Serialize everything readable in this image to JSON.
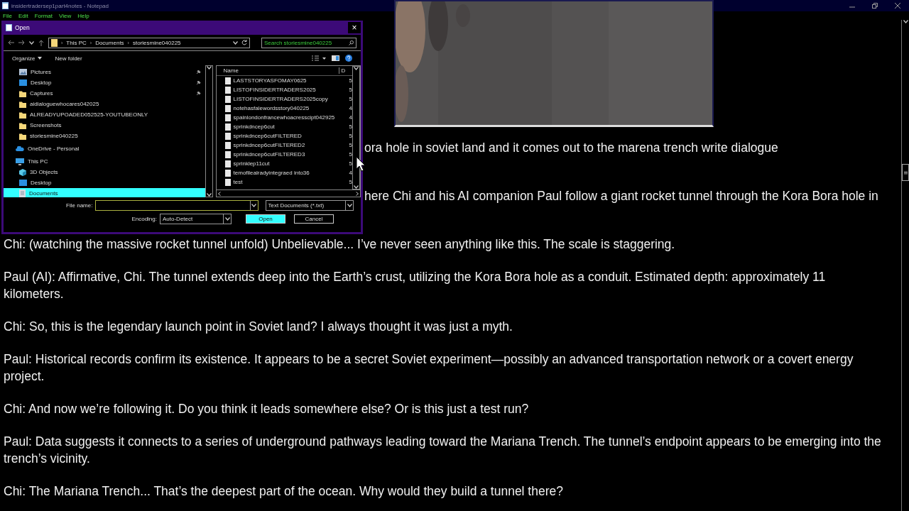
{
  "notepad": {
    "title": "insidertradersep1part4notes - Notepad",
    "menu": [
      "File",
      "Edit",
      "Format",
      "View",
      "Help"
    ],
    "paragraphs": [
      {
        "kind": "partial",
        "text": "ora hole in soviet land and it comes out to the marena trench write dialogue"
      },
      {
        "kind": "partial",
        "text": "here Chi and his AI companion Paul follow a giant rocket tunnel through the Kora Bora hole in"
      },
      {
        "kind": "full",
        "text": "Chi: (watching the massive rocket tunnel unfold) Unbelievable... I’ve never seen anything like this. The scale is staggering."
      },
      {
        "kind": "full",
        "text": "Paul (AI): Affirmative, Chi. The tunnel extends deep into the Earth’s crust, utilizing the Kora Bora hole as a conduit. Estimated depth: approximately 11 kilometers."
      },
      {
        "kind": "full",
        "text": "Chi: So, this is the legendary launch point in Soviet land? I always thought it was just a myth."
      },
      {
        "kind": "full",
        "text": "Paul: Historical records confirm its existence. It appears to be a secret Soviet experiment—possibly an advanced transportation network or a covert energy project."
      },
      {
        "kind": "full",
        "text": "Chi: And now we’re following it. Do you think it leads somewhere else? Or is this just a test run?"
      },
      {
        "kind": "full",
        "text": "Paul: Data suggests it connects to a series of underground pathways leading toward the Mariana Trench. The tunnel’s endpoint appears to be emerging into the trench’s vicinity."
      },
      {
        "kind": "full",
        "text": "Chi: The Mariana Trench... That’s the deepest part of the ocean. Why would they build a tunnel there?"
      }
    ]
  },
  "dialog": {
    "title": "Open",
    "close": "×",
    "address": {
      "segments": [
        {
          "separator": "›",
          "label": "This PC"
        },
        {
          "separator": "›",
          "label": "Documents"
        },
        {
          "separator": "›",
          "label": "storiesmine040225"
        }
      ]
    },
    "search": {
      "placeholder": "Search storiesmine040225"
    },
    "toolbar": {
      "organize": "Organize",
      "new_folder": "New folder"
    },
    "quick_access": [
      {
        "label": "Pictures",
        "kind": "pictures",
        "pinned": true,
        "selected": false
      },
      {
        "label": "Desktop",
        "kind": "desktop",
        "pinned": true,
        "selected": false
      },
      {
        "label": "Captures",
        "kind": "folder",
        "pinned": true,
        "selected": false
      },
      {
        "label": "aidialoguewhocares042025",
        "kind": "folder",
        "pinned": false,
        "selected": false
      },
      {
        "label": "ALREADYUPOADED052525-YOUTUBEONLY",
        "kind": "folder",
        "pinned": false,
        "selected": false
      },
      {
        "label": "Screenshots",
        "kind": "folder",
        "pinned": false,
        "selected": false
      },
      {
        "label": "storiesmine040225",
        "kind": "folder",
        "pinned": false,
        "selected": false
      }
    ],
    "tree": [
      {
        "label": "OneDrive - Personal",
        "kind": "cloud",
        "selected": false
      },
      {
        "label": "This PC",
        "kind": "pc",
        "selected": false,
        "children": [
          {
            "label": "3D Objects",
            "kind": "cube",
            "selected": false
          },
          {
            "label": "Desktop",
            "kind": "desktop",
            "selected": false
          },
          {
            "label": "Documents",
            "kind": "docs",
            "selected": true
          }
        ]
      }
    ],
    "columns": [
      "Name",
      "D"
    ],
    "files": [
      {
        "name": "LASTSTORYASFOMAY0625",
        "column_2": "5"
      },
      {
        "name": "LISTOFINSIDERTRADERS2025",
        "column_2": "5"
      },
      {
        "name": "LISTOFINSIDERTRADERS2025copy",
        "column_2": "5"
      },
      {
        "name": "notehasfalewordsstory040225",
        "column_2": "4"
      },
      {
        "name": "spainlondonfrancewhoacresscipt042925",
        "column_2": "4"
      },
      {
        "name": "sprinkdncep6cut",
        "column_2": "5"
      },
      {
        "name": "sprinkdncep6cutFILTERED",
        "column_2": "5"
      },
      {
        "name": "sprinkdncep6cutFILTERED2",
        "column_2": "5"
      },
      {
        "name": "sprinkdncep6cutFILTERED3",
        "column_2": "5"
      },
      {
        "name": "sprinklep11cut",
        "column_2": "5"
      },
      {
        "name": "temofilealradyintegraed into36",
        "column_2": "4"
      },
      {
        "name": "test",
        "column_2": "5"
      }
    ],
    "file_name": {
      "label": "File name:"
    },
    "file_type": "Text Documents (*.txt)",
    "encoding": {
      "label": "Encoding:",
      "value": "Auto-Detect"
    },
    "buttons": [
      {
        "label": "Open",
        "kind": "primary"
      },
      {
        "label": "Cancel",
        "kind": "secondary"
      }
    ]
  }
}
